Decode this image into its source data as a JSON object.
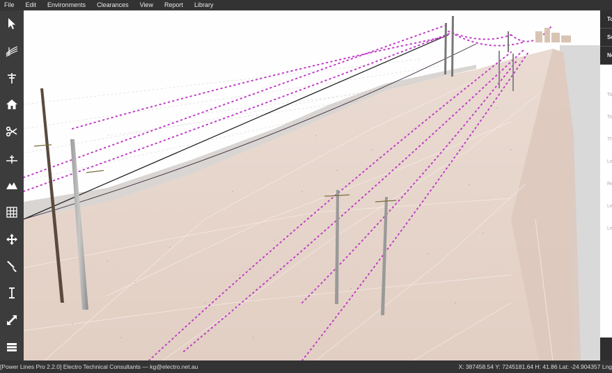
{
  "menu": [
    "File",
    "Edit",
    "Environments",
    "Clearances",
    "View",
    "Report",
    "Library"
  ],
  "toolbar": [
    {
      "icon": "pointer-icon"
    },
    {
      "icon": "conductor-icon"
    },
    {
      "icon": "pole-icon"
    },
    {
      "icon": "house-icon"
    },
    {
      "icon": "scissors-icon"
    },
    {
      "icon": "span-split-icon"
    },
    {
      "icon": "terrain-icon"
    },
    {
      "icon": "grid-icon"
    },
    {
      "icon": "move-icon"
    },
    {
      "icon": "knife-icon"
    },
    {
      "icon": "clearance-measure-icon"
    },
    {
      "icon": "expand-icon"
    },
    {
      "icon": "layers-icon"
    }
  ],
  "right_panel": {
    "tabs": [
      "To",
      "Se",
      "Ne"
    ],
    "lines": [
      "To",
      "bu",
      "ve",
      "To",
      "bu",
      "Th",
      "m",
      "m",
      "Le",
      "on",
      "cu",
      "Re",
      "Le",
      "ot",
      "Le",
      "an"
    ]
  },
  "status": {
    "left": "[Power Lines Pro 2.2.0]   Electro Technical Consultants — kg@electro.net.au",
    "right": "X: 387458.54 Y: 7245181.64 H: 41.86 Lat: -24.904357 Lng"
  },
  "colors": {
    "conductor": "#c23cc8",
    "terrain": "#e3d2c8",
    "chrome": "#333333"
  }
}
